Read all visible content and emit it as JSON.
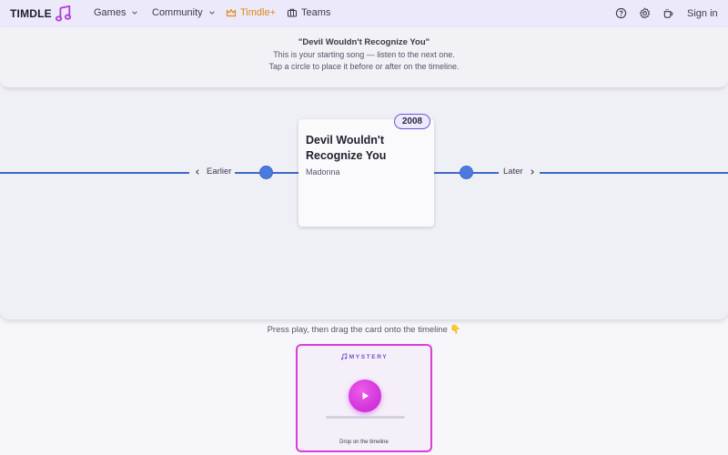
{
  "nav": {
    "brand": "TIMDLE",
    "items": [
      {
        "label": "Games",
        "has_dropdown": true
      },
      {
        "label": "Community",
        "has_dropdown": true
      },
      {
        "label": "Timdle+",
        "icon": "crown-icon"
      },
      {
        "label": "Teams",
        "icon": "briefcase-icon"
      }
    ],
    "right_icons": [
      "help-icon",
      "gear-icon",
      "coffee-icon"
    ],
    "signin": "Sign in"
  },
  "info": {
    "title": "\"Devil Wouldn't Recognize You\"",
    "line1": "This is your starting song — listen to the next one.",
    "line2": "Tap a circle to place it before or after on the timeline."
  },
  "timeline": {
    "earlier_label": "Earlier",
    "later_label": "Later",
    "card": {
      "year": "2008",
      "title": "Devil Wouldn't Recognize You",
      "artist": "Madonna"
    }
  },
  "hint": "Press play, then drag the card onto the timeline 👇",
  "mystery": {
    "header": "MYSTERY",
    "progress": 0,
    "drop_label": "Drop on the timeline"
  },
  "colors": {
    "accent": "#c220d4",
    "timeline": "#3f69c9",
    "badge_border": "#6a55d8",
    "plus": "#e08a12"
  }
}
